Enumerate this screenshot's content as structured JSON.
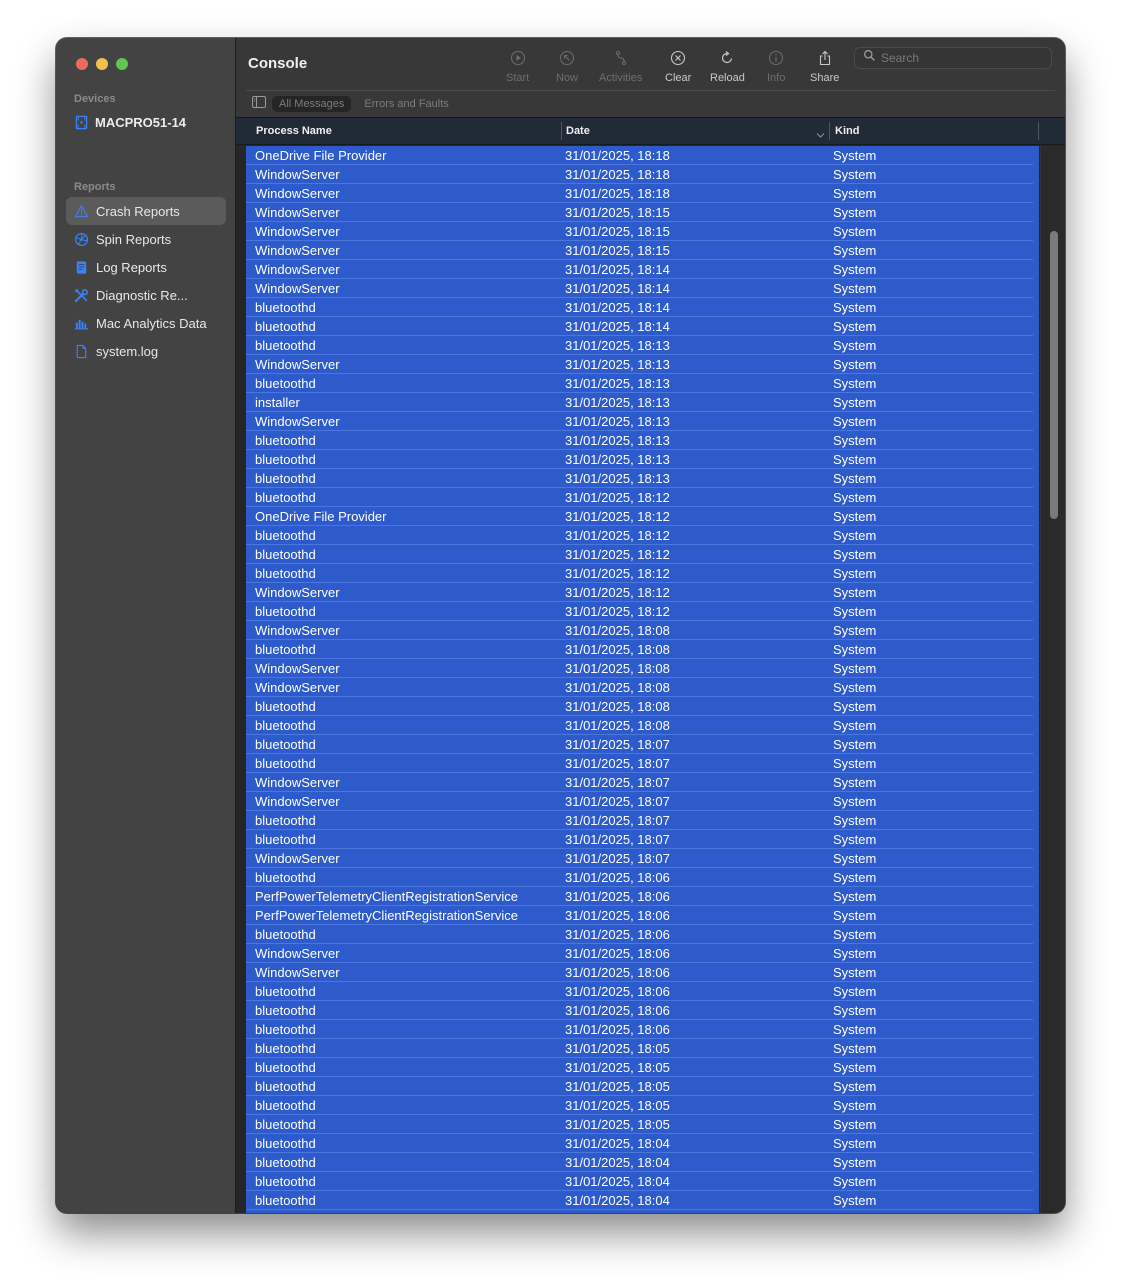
{
  "window": {
    "app_title": "Console"
  },
  "sidebar": {
    "devices_label": "Devices",
    "device": {
      "name": "MACPRO51-14",
      "icon": "mac-pro-icon"
    },
    "reports_label": "Reports",
    "items": [
      {
        "label": "Crash Reports",
        "icon": "warning-triangle-icon",
        "active": true
      },
      {
        "label": "Spin Reports",
        "icon": "spin-wheel-icon",
        "active": false
      },
      {
        "label": "Log Reports",
        "icon": "document-lines-icon",
        "active": false
      },
      {
        "label": "Diagnostic Re...",
        "icon": "wrench-screwdriver-icon",
        "active": false
      },
      {
        "label": "Mac Analytics Data",
        "icon": "bar-chart-icon",
        "active": false
      },
      {
        "label": "system.log",
        "icon": "document-icon",
        "active": false
      }
    ]
  },
  "toolbar": {
    "buttons": [
      {
        "label": "Start",
        "icon": "play-circle-icon",
        "enabled": false
      },
      {
        "label": "Now",
        "icon": "arrow-up-left-circle-icon",
        "enabled": false
      },
      {
        "label": "Activities",
        "icon": "activities-icon",
        "enabled": false
      },
      {
        "label": "Clear",
        "icon": "x-circle-icon",
        "enabled": true
      },
      {
        "label": "Reload",
        "icon": "reload-icon",
        "enabled": true
      },
      {
        "label": "Info",
        "icon": "info-circle-icon",
        "enabled": false
      },
      {
        "label": "Share",
        "icon": "share-icon",
        "enabled": true
      }
    ],
    "search": {
      "placeholder": "Search",
      "value": ""
    },
    "filters": [
      {
        "label": "All Messages",
        "active": true
      },
      {
        "label": "Errors and Faults",
        "active": false
      }
    ]
  },
  "table": {
    "columns": [
      "Process Name",
      "Date",
      "Kind"
    ],
    "sorted_column": "Date",
    "rows": [
      [
        "OneDrive File Provider",
        "31/01/2025, 18:18",
        "System"
      ],
      [
        "WindowServer",
        "31/01/2025, 18:18",
        "System"
      ],
      [
        "WindowServer",
        "31/01/2025, 18:18",
        "System"
      ],
      [
        "WindowServer",
        "31/01/2025, 18:15",
        "System"
      ],
      [
        "WindowServer",
        "31/01/2025, 18:15",
        "System"
      ],
      [
        "WindowServer",
        "31/01/2025, 18:15",
        "System"
      ],
      [
        "WindowServer",
        "31/01/2025, 18:14",
        "System"
      ],
      [
        "WindowServer",
        "31/01/2025, 18:14",
        "System"
      ],
      [
        "bluetoothd",
        "31/01/2025, 18:14",
        "System"
      ],
      [
        "bluetoothd",
        "31/01/2025, 18:14",
        "System"
      ],
      [
        "bluetoothd",
        "31/01/2025, 18:13",
        "System"
      ],
      [
        "WindowServer",
        "31/01/2025, 18:13",
        "System"
      ],
      [
        "bluetoothd",
        "31/01/2025, 18:13",
        "System"
      ],
      [
        "installer",
        "31/01/2025, 18:13",
        "System"
      ],
      [
        "WindowServer",
        "31/01/2025, 18:13",
        "System"
      ],
      [
        "bluetoothd",
        "31/01/2025, 18:13",
        "System"
      ],
      [
        "bluetoothd",
        "31/01/2025, 18:13",
        "System"
      ],
      [
        "bluetoothd",
        "31/01/2025, 18:13",
        "System"
      ],
      [
        "bluetoothd",
        "31/01/2025, 18:12",
        "System"
      ],
      [
        "OneDrive File Provider",
        "31/01/2025, 18:12",
        "System"
      ],
      [
        "bluetoothd",
        "31/01/2025, 18:12",
        "System"
      ],
      [
        "bluetoothd",
        "31/01/2025, 18:12",
        "System"
      ],
      [
        "bluetoothd",
        "31/01/2025, 18:12",
        "System"
      ],
      [
        "WindowServer",
        "31/01/2025, 18:12",
        "System"
      ],
      [
        "bluetoothd",
        "31/01/2025, 18:12",
        "System"
      ],
      [
        "WindowServer",
        "31/01/2025, 18:08",
        "System"
      ],
      [
        "bluetoothd",
        "31/01/2025, 18:08",
        "System"
      ],
      [
        "WindowServer",
        "31/01/2025, 18:08",
        "System"
      ],
      [
        "WindowServer",
        "31/01/2025, 18:08",
        "System"
      ],
      [
        "bluetoothd",
        "31/01/2025, 18:08",
        "System"
      ],
      [
        "bluetoothd",
        "31/01/2025, 18:08",
        "System"
      ],
      [
        "bluetoothd",
        "31/01/2025, 18:07",
        "System"
      ],
      [
        "bluetoothd",
        "31/01/2025, 18:07",
        "System"
      ],
      [
        "WindowServer",
        "31/01/2025, 18:07",
        "System"
      ],
      [
        "WindowServer",
        "31/01/2025, 18:07",
        "System"
      ],
      [
        "bluetoothd",
        "31/01/2025, 18:07",
        "System"
      ],
      [
        "bluetoothd",
        "31/01/2025, 18:07",
        "System"
      ],
      [
        "WindowServer",
        "31/01/2025, 18:07",
        "System"
      ],
      [
        "bluetoothd",
        "31/01/2025, 18:06",
        "System"
      ],
      [
        "PerfPowerTelemetryClientRegistrationService",
        "31/01/2025, 18:06",
        "System"
      ],
      [
        "PerfPowerTelemetryClientRegistrationService",
        "31/01/2025, 18:06",
        "System"
      ],
      [
        "bluetoothd",
        "31/01/2025, 18:06",
        "System"
      ],
      [
        "WindowServer",
        "31/01/2025, 18:06",
        "System"
      ],
      [
        "WindowServer",
        "31/01/2025, 18:06",
        "System"
      ],
      [
        "bluetoothd",
        "31/01/2025, 18:06",
        "System"
      ],
      [
        "bluetoothd",
        "31/01/2025, 18:06",
        "System"
      ],
      [
        "bluetoothd",
        "31/01/2025, 18:06",
        "System"
      ],
      [
        "bluetoothd",
        "31/01/2025, 18:05",
        "System"
      ],
      [
        "bluetoothd",
        "31/01/2025, 18:05",
        "System"
      ],
      [
        "bluetoothd",
        "31/01/2025, 18:05",
        "System"
      ],
      [
        "bluetoothd",
        "31/01/2025, 18:05",
        "System"
      ],
      [
        "bluetoothd",
        "31/01/2025, 18:05",
        "System"
      ],
      [
        "bluetoothd",
        "31/01/2025, 18:04",
        "System"
      ],
      [
        "bluetoothd",
        "31/01/2025, 18:04",
        "System"
      ],
      [
        "bluetoothd",
        "31/01/2025, 18:04",
        "System"
      ],
      [
        "bluetoothd",
        "31/01/2025, 18:04",
        "System"
      ]
    ],
    "selection_color": "#2d5bcc",
    "scroll": {
      "thumb_start_fraction": 0.08,
      "thumb_length_fraction": 0.27
    }
  },
  "colors": {
    "accent_blue": "#3b82f6",
    "traffic_close": "#ed6a5e",
    "traffic_min": "#f5bf4f",
    "traffic_max": "#62c554"
  }
}
